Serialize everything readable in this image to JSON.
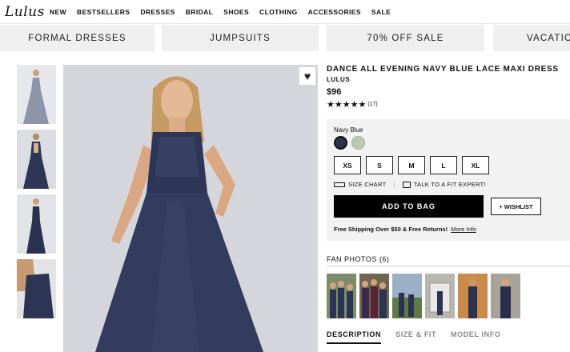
{
  "header": {
    "logo": "Lulus",
    "nav": [
      "NEW",
      "BESTSELLERS",
      "DRESSES",
      "BRIDAL",
      "SHOES",
      "CLOTHING",
      "ACCESSORIES",
      "SALE"
    ]
  },
  "categories": [
    "FORMAL DRESSES",
    "JUMPSUITS",
    "70% OFF SALE",
    "VACATIO"
  ],
  "product": {
    "title": "DANCE ALL EVENING NAVY BLUE LACE MAXI DRESS",
    "brand": "LULUS",
    "price": "$96",
    "stars": "★★★★★",
    "review_count": "(17)",
    "color_label": "Navy Blue",
    "colors": [
      "#2b3350",
      "#b9c9b3"
    ],
    "sizes": [
      "XS",
      "S",
      "M",
      "L",
      "XL"
    ],
    "size_chart": "SIZE CHART",
    "fit_expert": "TALK TO A FIT EXPERT!",
    "add_to_bag": "ADD TO BAG",
    "wishlist": "+ WISHLIST",
    "shipping": "Free Shipping Over $50 & Free Returns!",
    "more_info": "More Info",
    "favorite_icon": "heart-icon"
  },
  "fan_photos": {
    "label": "FAN PHOTOS (6)"
  },
  "tabs": [
    "DESCRIPTION",
    "SIZE & FIT",
    "MODEL INFO"
  ]
}
